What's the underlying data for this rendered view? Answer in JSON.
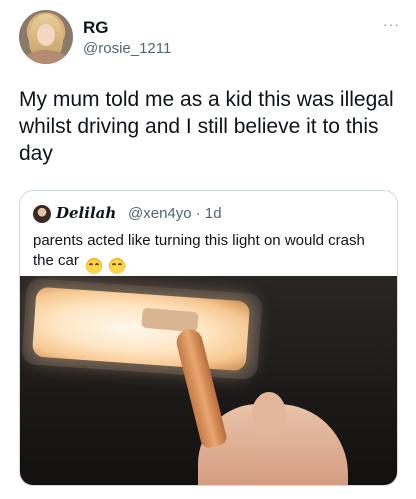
{
  "tweet": {
    "display_name": "RG",
    "handle": "@rosie_1211",
    "more_glyph": "···",
    "text": "My mum told me as a kid this was illegal whilst driving and I still believe it to this day"
  },
  "quoted": {
    "display_name": "𝑫𝒆𝒍𝒊𝒍𝒂𝒉",
    "handle_time": "@xen4yo · 1d",
    "text": "parents acted like turning this light on would crash the car",
    "emojis": [
      "😭",
      "😭"
    ],
    "image": "hand pressing car interior dome light switch"
  },
  "icons": {
    "more": "more-horizontal-icon",
    "emoji": "loudly-crying-face-emoji"
  }
}
